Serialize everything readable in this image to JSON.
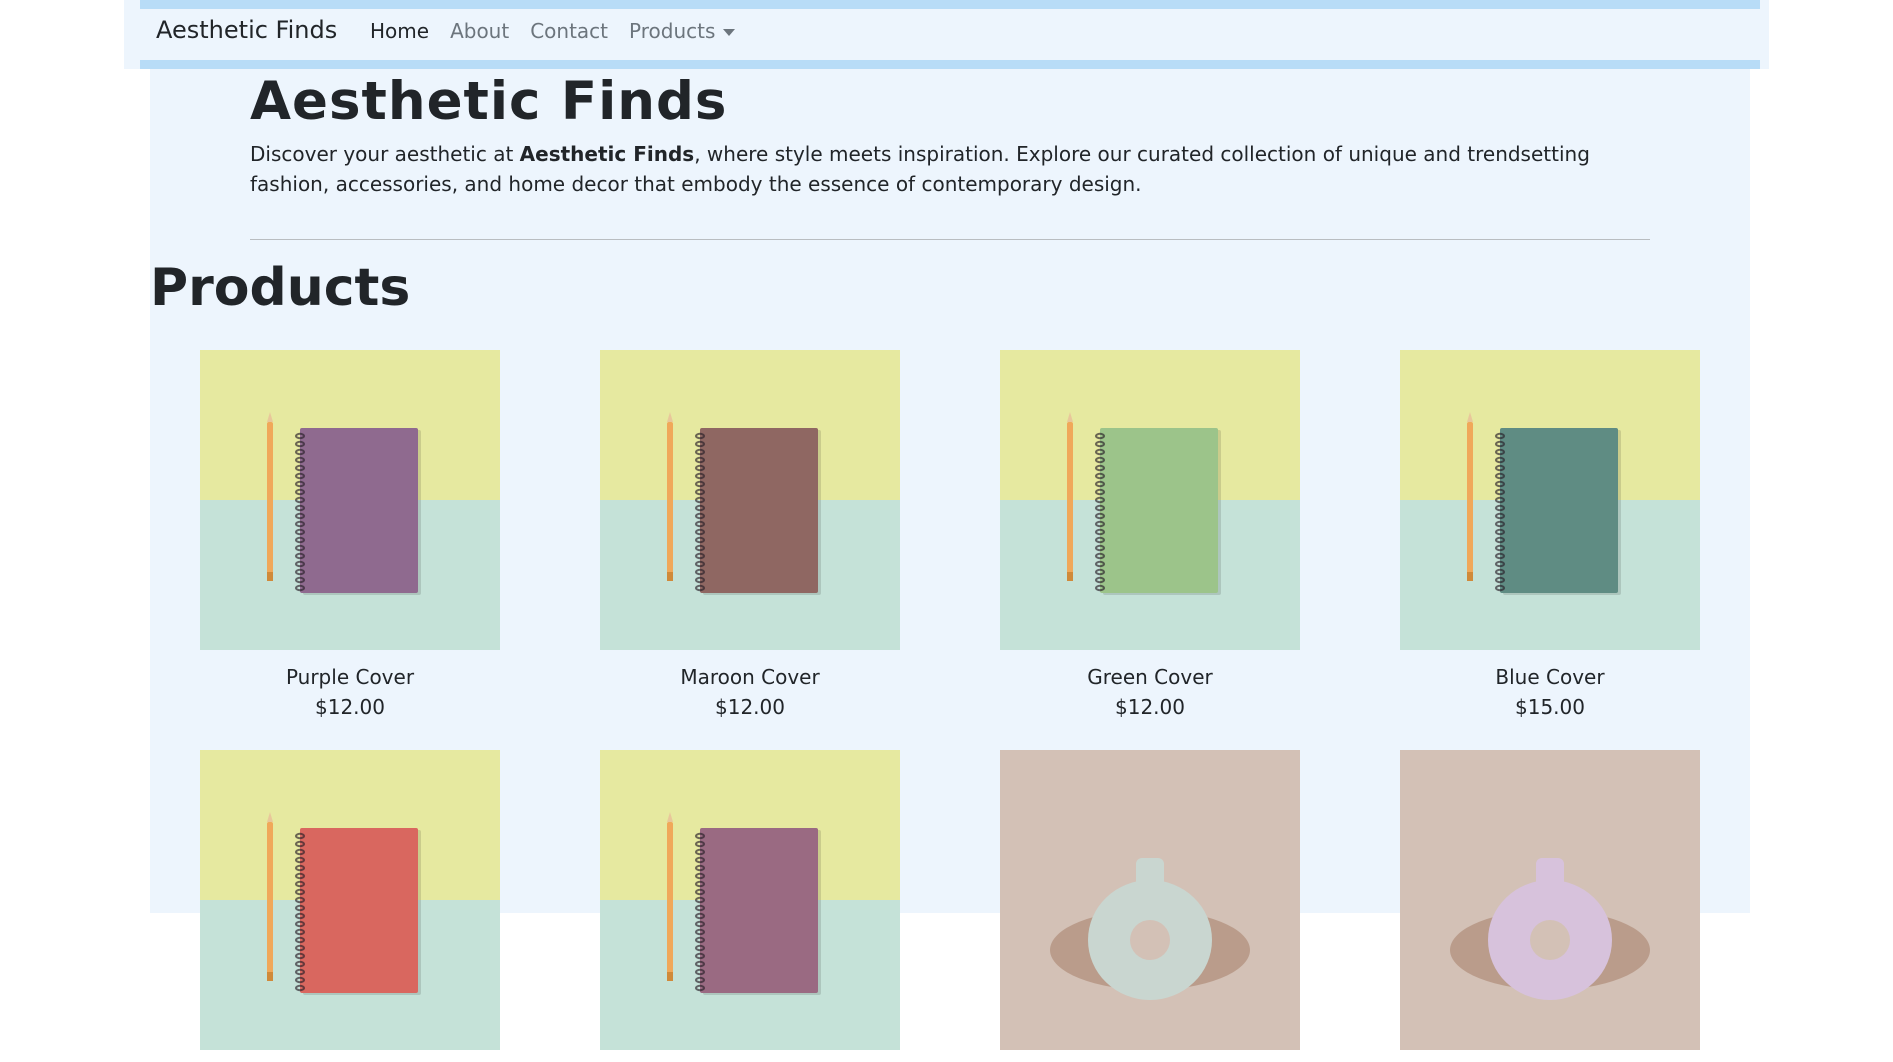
{
  "navbar": {
    "brand": "Aesthetic Finds",
    "links": [
      {
        "label": "Home",
        "active": true
      },
      {
        "label": "About",
        "active": false
      },
      {
        "label": "Contact",
        "active": false
      },
      {
        "label": "Products",
        "active": false,
        "dropdown": true
      }
    ]
  },
  "hero": {
    "title": "Aesthetic Finds",
    "description_pre": "Discover your aesthetic at ",
    "description_bold": "Aesthetic Finds",
    "description_post": ", where style meets inspiration. Explore our curated collection of unique and trendsetting fashion, accessories, and home decor that embody the essence of contemporary design."
  },
  "products_section": {
    "heading": "Products",
    "items": [
      {
        "name": "Purple Cover",
        "price": "$12.00",
        "cover_color": "#8f6a8f",
        "image": "notebook"
      },
      {
        "name": "Maroon Cover",
        "price": "$12.00",
        "cover_color": "#8f6762",
        "image": "notebook"
      },
      {
        "name": "Green Cover",
        "price": "$12.00",
        "cover_color": "#9cc48a",
        "image": "notebook"
      },
      {
        "name": "Blue Cover",
        "price": "$15.00",
        "cover_color": "#5f8c83",
        "image": "notebook"
      },
      {
        "name": "",
        "price": "",
        "cover_color": "#d9675f",
        "image": "notebook"
      },
      {
        "name": "",
        "price": "",
        "cover_color": "#9a6a82",
        "image": "notebook"
      },
      {
        "name": "",
        "price": "",
        "vase_color": "#c9d6d0",
        "image": "vase"
      },
      {
        "name": "",
        "price": "",
        "vase_color": "#d7c2dc",
        "image": "vase"
      }
    ]
  },
  "colors": {
    "page_background": "#edf5fd",
    "nav_stripe": "#b8dcf7",
    "photo_yellow": "#e6e9a0",
    "photo_mint": "#c5e2d8",
    "photo_beige": "#d3c1b6"
  }
}
